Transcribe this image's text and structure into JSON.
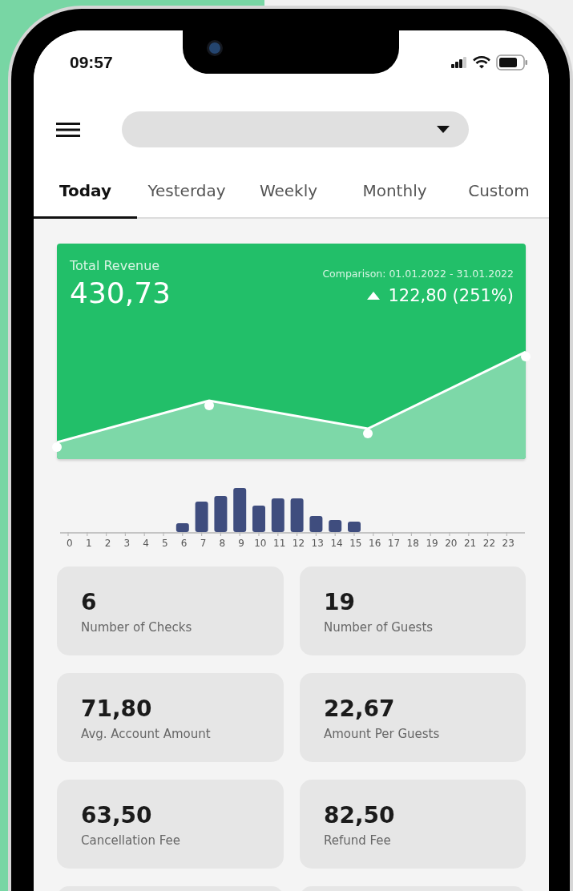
{
  "status_bar": {
    "time": "09:57"
  },
  "tabs": [
    {
      "label": "Today",
      "selected": true
    },
    {
      "label": "Yesterday",
      "selected": false
    },
    {
      "label": "Weekly",
      "selected": false
    },
    {
      "label": "Monthly",
      "selected": false
    },
    {
      "label": "Custom",
      "selected": false
    }
  ],
  "revenue": {
    "title": "Total Revenue",
    "value": "430,73",
    "comparison": "Comparison: 01.01.2022 - 31.01.2022",
    "trend_up": true,
    "change": "122,80 (251%)"
  },
  "hourly_chart": {
    "hour_labels": [
      "0",
      "1",
      "2",
      "3",
      "4",
      "5",
      "6",
      "7",
      "8",
      "9",
      "10",
      "11",
      "12",
      "13",
      "14",
      "15",
      "16",
      "17",
      "18",
      "19",
      "20",
      "21",
      "22",
      "23"
    ]
  },
  "stats": [
    {
      "value": "6",
      "label": "Number of Checks"
    },
    {
      "value": "19",
      "label": "Number of Guests"
    },
    {
      "value": "71,80",
      "label": "Avg. Account Amount"
    },
    {
      "value": "22,67",
      "label": "Amount Per Guests"
    },
    {
      "value": "63,50",
      "label": "Cancellation Fee"
    },
    {
      "value": "82,50",
      "label": "Refund Fee"
    }
  ]
}
